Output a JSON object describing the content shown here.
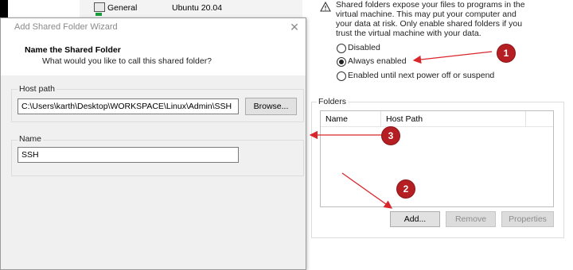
{
  "background": {
    "general_label": "General",
    "general_value": "Ubuntu 20.04",
    "warning_lines": [
      "Shared folders expose your files to programs in the",
      "virtual machine. This may put your computer and",
      "your data at risk. Only enable shared folders if you",
      "trust the virtual machine with your data."
    ],
    "radios": [
      {
        "label": "Disabled",
        "selected": false
      },
      {
        "label": "Always enabled",
        "selected": true
      },
      {
        "label": "Enabled until next power off or suspend",
        "selected": false
      }
    ],
    "folders_group_label": "Folders",
    "table_headers": [
      "Name",
      "Host Path"
    ],
    "buttons": {
      "add": "Add...",
      "remove": "Remove",
      "properties": "Properties"
    }
  },
  "dialog": {
    "title": "Add Shared Folder Wizard",
    "close_glyph": "✕",
    "page_title": "Name the Shared Folder",
    "page_subtitle": "What would you like to call this shared folder?",
    "host_path_label": "Host path",
    "host_path_value": "C:\\Users\\karth\\Desktop\\WORKSPACE\\Linux\\Admin\\SSH",
    "browse_label": "Browse...",
    "name_label": "Name",
    "name_value": "SSH"
  },
  "annotations": {
    "badge_1": "1",
    "badge_2": "2",
    "badge_3": "3",
    "arrow_color": "#d9262c",
    "badge_color": "#b51f24"
  }
}
